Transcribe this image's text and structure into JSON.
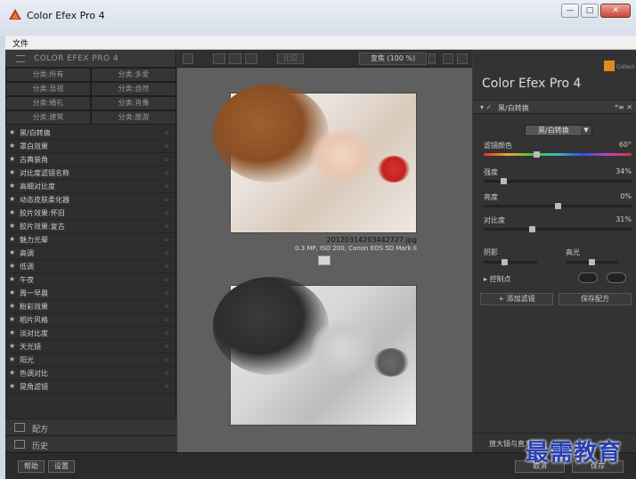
{
  "window": {
    "title": "Color Efex Pro 4",
    "min": "—",
    "max": "□",
    "close": "✕"
  },
  "menu": {
    "file": "文件"
  },
  "left_panel": {
    "header": "COLOR EFEX PRO 4",
    "categories": [
      "分类:所有",
      "分类:多爱",
      "分类:显视",
      "分类:自然",
      "分类:婚礼",
      "分类:肖像",
      "分类:建筑",
      "分类:旅游"
    ],
    "filters": [
      "黑/白转换",
      "罩白效果",
      "古典装角",
      "对比度滤镜名称",
      "高细对比度",
      "动态皮肤柔化器",
      "胶片效果:怀旧",
      "胶片效果:复古",
      "魅力光晕",
      "高调",
      "低调",
      "午夜",
      "周一早晨",
      "粉彩效果",
      "相片风格",
      "淡对比度",
      "天光镜",
      "阳光",
      "色调对比",
      "晃角滤镜"
    ],
    "recipes": "配方",
    "history": "历史"
  },
  "center": {
    "toolbar_compare": "比较",
    "zoom": "变焦 (100 %)",
    "file_name": "20120314203442727.jpg",
    "file_info": "0.3 MP, ISO 200, Canon EOS 5D Mark II"
  },
  "right_panel": {
    "brand": "Collection",
    "title_main": "Color Efex Pro",
    "title_num": "4",
    "filter_name": "黑/白转换",
    "filter_icons": "*≡ ✕",
    "dropdown": "黑/白转换",
    "params": [
      {
        "label": "滤镜颜色",
        "value": "60°",
        "pos": 0.35
      },
      {
        "label": "强度",
        "value": "34%",
        "pos": 0.12
      },
      {
        "label": "亮度",
        "value": "0%",
        "pos": 0.5
      },
      {
        "label": "对比度",
        "value": "31%",
        "pos": 0.32
      }
    ],
    "shadows": "阴影",
    "highlights": "高光",
    "control_points": "控制点",
    "add_filter": "添加滤镜",
    "save_recipe": "保存配方",
    "footer": "放大镜与直方图"
  },
  "bottom": {
    "help": "帮助",
    "settings": "设置",
    "cancel": "取消",
    "save": "保存"
  },
  "watermark": "最需教育"
}
